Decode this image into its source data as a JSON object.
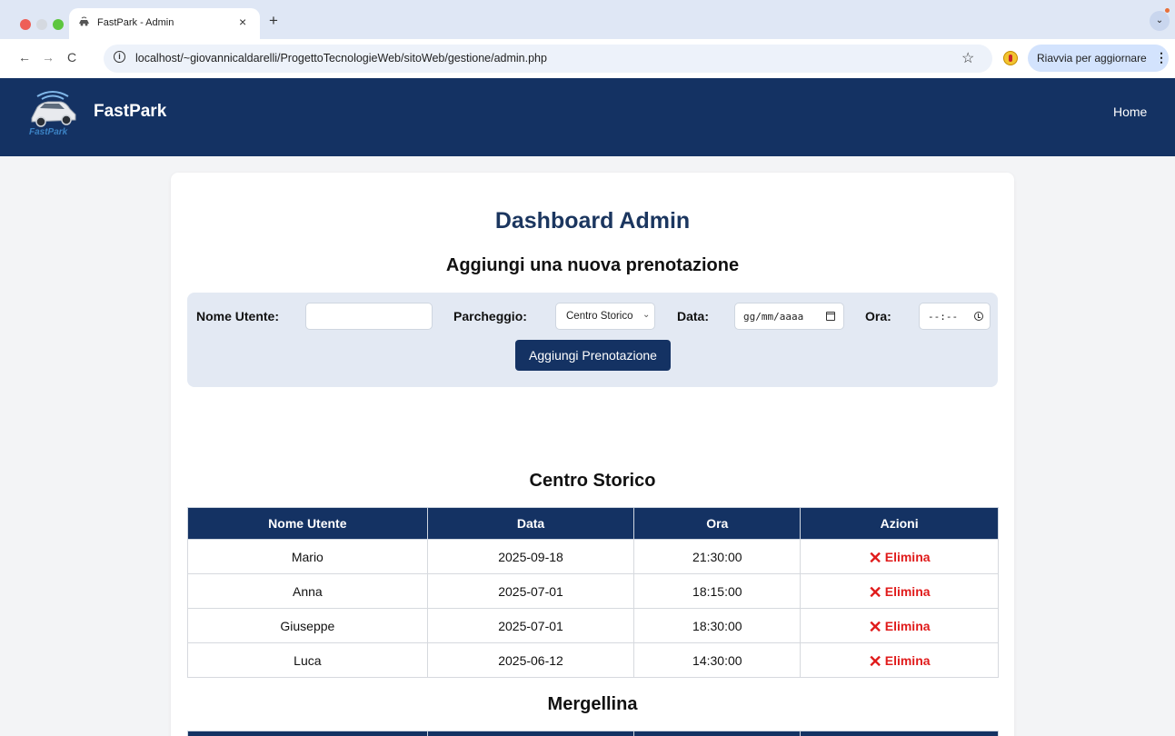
{
  "browser": {
    "tab_title": "FastPark - Admin",
    "url": "localhost/~giovannicaldarelli/ProgettoTecnologieWeb/sitoWeb/gestione/admin.php",
    "update_button": "Riavvia per aggiornare",
    "tab_close": "×",
    "new_tab": "+",
    "back": "←",
    "forward": "→",
    "reload": "C",
    "star": "☆",
    "tabs_menu": "⌄",
    "info": "i",
    "kebab": "⋮"
  },
  "header": {
    "brand": "FastPark",
    "nav": {
      "home": "Home"
    },
    "background_color": "#143263"
  },
  "main": {
    "title": "Dashboard Admin",
    "form": {
      "title": "Aggiungi una nuova prenotazione",
      "user_label": "Nome Utente:",
      "user_value": "",
      "parking_label": "Parcheggio:",
      "parking_selected": "Centro Storico",
      "select_chevron": "⌄",
      "date_label": "Data:",
      "date_placeholder": "gg/mm/aaaa",
      "time_label": "Ora:",
      "time_placeholder": "--:--",
      "submit": "Aggiungi Prenotazione"
    },
    "columns": [
      "Nome Utente",
      "Data",
      "Ora",
      "Azioni"
    ],
    "delete_label": "Elimina",
    "delete_icon": "✕",
    "sections": [
      {
        "name": "Centro Storico",
        "rows": [
          {
            "user": "Mario",
            "date": "2025-09-18",
            "time": "21:30:00"
          },
          {
            "user": "Anna",
            "date": "2025-07-01",
            "time": "18:15:00"
          },
          {
            "user": "Giuseppe",
            "date": "2025-07-01",
            "time": "18:30:00"
          },
          {
            "user": "Luca",
            "date": "2025-06-12",
            "time": "14:30:00"
          }
        ]
      },
      {
        "name": "Mergellina",
        "rows": []
      }
    ],
    "delete_color": "#e01b1b"
  }
}
